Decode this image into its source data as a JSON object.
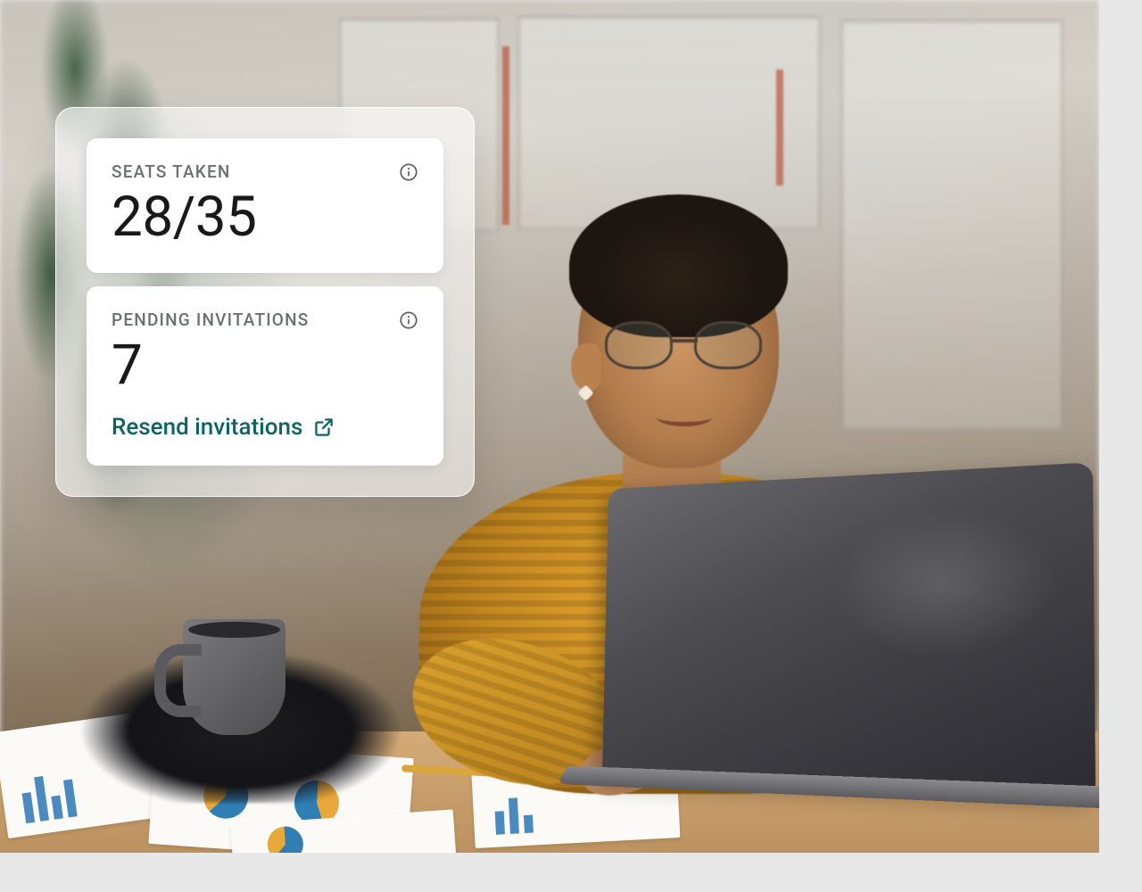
{
  "cards": {
    "seats": {
      "label": "SEATS TAKEN",
      "value": "28/35"
    },
    "pending": {
      "label": "PENDING INVITATIONS",
      "value": "7",
      "link_label": "Resend invitations"
    }
  },
  "colors": {
    "link": "#0d6365",
    "label": "#6a6f70",
    "value": "#181a1a"
  }
}
